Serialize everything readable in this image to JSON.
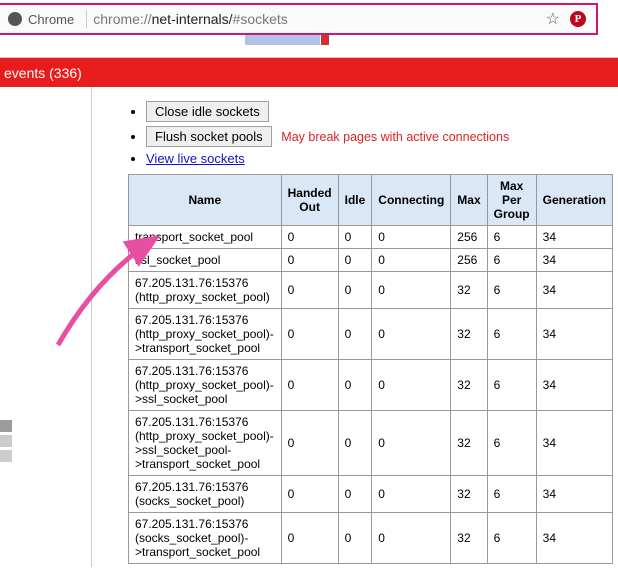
{
  "omnibox": {
    "label": "Chrome",
    "url_prefix": "chrome://",
    "url_path": "net-internals/",
    "url_hash": "#sockets"
  },
  "events_bar": "events (336)",
  "actions": {
    "close_idle": "Close idle sockets",
    "flush": "Flush socket pools",
    "flush_warning": "May break pages with active connections",
    "view_live": "View live sockets"
  },
  "table": {
    "headers": {
      "name": "Name",
      "handed_out": "Handed Out",
      "idle": "Idle",
      "connecting": "Connecting",
      "max": "Max",
      "max_per_group": "Max Per Group",
      "generation": "Generation"
    },
    "rows": [
      {
        "name": "transport_socket_pool",
        "handed_out": "0",
        "idle": "0",
        "connecting": "0",
        "max": "256",
        "mpg": "6",
        "gen": "34"
      },
      {
        "name": "ssl_socket_pool",
        "handed_out": "0",
        "idle": "0",
        "connecting": "0",
        "max": "256",
        "mpg": "6",
        "gen": "34"
      },
      {
        "name": "67.205.131.76:15376 (http_proxy_socket_pool)",
        "handed_out": "0",
        "idle": "0",
        "connecting": "0",
        "max": "32",
        "mpg": "6",
        "gen": "34"
      },
      {
        "name": "67.205.131.76:15376 (http_proxy_socket_pool)->transport_socket_pool",
        "handed_out": "0",
        "idle": "0",
        "connecting": "0",
        "max": "32",
        "mpg": "6",
        "gen": "34"
      },
      {
        "name": "67.205.131.76:15376 (http_proxy_socket_pool)->ssl_socket_pool",
        "handed_out": "0",
        "idle": "0",
        "connecting": "0",
        "max": "32",
        "mpg": "6",
        "gen": "34"
      },
      {
        "name": "67.205.131.76:15376 (http_proxy_socket_pool)->ssl_socket_pool->transport_socket_pool",
        "handed_out": "0",
        "idle": "0",
        "connecting": "0",
        "max": "32",
        "mpg": "6",
        "gen": "34"
      },
      {
        "name": "67.205.131.76:15376 (socks_socket_pool)",
        "handed_out": "0",
        "idle": "0",
        "connecting": "0",
        "max": "32",
        "mpg": "6",
        "gen": "34"
      },
      {
        "name": "67.205.131.76:15376 (socks_socket_pool)->transport_socket_pool",
        "handed_out": "0",
        "idle": "0",
        "connecting": "0",
        "max": "32",
        "mpg": "6",
        "gen": "34"
      }
    ]
  }
}
